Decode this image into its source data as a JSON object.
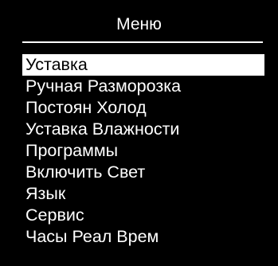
{
  "header": {
    "title": "Меню"
  },
  "menu": {
    "selected_index": 0,
    "items": [
      {
        "label": "Уставка"
      },
      {
        "label": "Ручная Разморозка"
      },
      {
        "label": "Постоян Холод"
      },
      {
        "label": "Уставка Влажности"
      },
      {
        "label": "Программы"
      },
      {
        "label": "Включить Свет"
      },
      {
        "label": "Язык"
      },
      {
        "label": "Сервис"
      },
      {
        "label": "Часы Реал Врем"
      }
    ]
  },
  "colors": {
    "background": "#000000",
    "foreground": "#ffffff",
    "selected_background": "#ffffff",
    "selected_text": "#000000"
  }
}
